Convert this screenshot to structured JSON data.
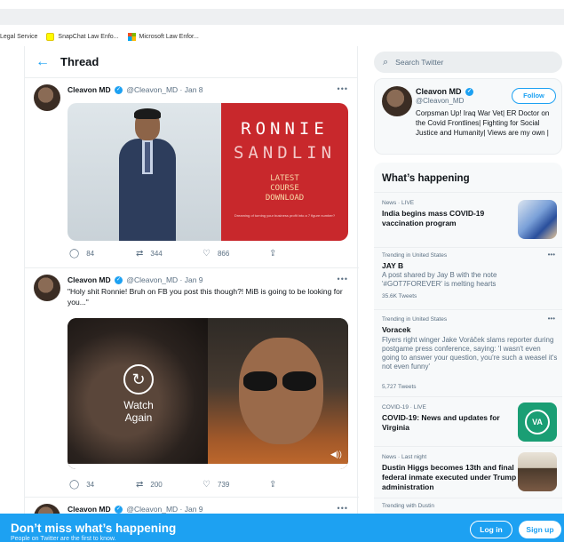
{
  "bookmarks": [
    {
      "label": "Legal Service",
      "icon": "none"
    },
    {
      "label": "SnapChat Law Enfo...",
      "icon": "snapchat-icon"
    },
    {
      "label": "Microsoft Law Enfor...",
      "icon": "microsoft-icon"
    }
  ],
  "thread": {
    "back_icon": "←",
    "title": "Thread"
  },
  "tweets": [
    {
      "name": "Cleavon MD",
      "handle": "@Cleavon_MD",
      "date": "· Jan 8",
      "text": "",
      "media": {
        "name_line1": "RONNIE",
        "name_line2": "SANDLIN",
        "sub_line1": "LATEST",
        "sub_line2": "COURSE",
        "sub_line3": "DOWNLOAD",
        "tiny_text": "Dreaming of turning your business profit into a 7 figure number?"
      },
      "replies": "84",
      "retweets": "344",
      "likes": "866"
    },
    {
      "name": "Cleavon MD",
      "handle": "@Cleavon_MD",
      "date": "· Jan 9",
      "text": "\"Holy shit Ronnie! Bruh on FB you post this though?! MiB is going to be looking for you...\"",
      "media": {
        "watch_label_1": "Watch",
        "watch_label_2": "Again"
      },
      "replies": "34",
      "retweets": "200",
      "likes": "739"
    },
    {
      "name": "Cleavon MD",
      "handle": "@Cleavon_MD",
      "date": "· Jan 9"
    }
  ],
  "search": {
    "placeholder": "Search Twitter"
  },
  "profile": {
    "name": "Cleavon MD",
    "handle": "@Cleavon_MD",
    "follow_label": "Follow",
    "bio": "Corpsman Up! Iraq War Vet| ER Doctor on the Covid Frontlines| Fighting for Social Justice and Humanity| Views are my own |"
  },
  "happening": {
    "title": "What’s happening",
    "trends": [
      {
        "meta": "News · LIVE",
        "title": "India begins mass COVID-19 vaccination program",
        "desc": "",
        "count": ""
      },
      {
        "meta": "Trending in United States",
        "title": "JAY B",
        "desc": "A post shared by Jay B with the note '#GOT7FOREVER' is melting hearts",
        "count": "35.6K Tweets"
      },
      {
        "meta": "Trending in United States",
        "title": "Voracek",
        "desc": "Flyers right winger Jake Voráček slams reporter during postgame press conference, saying: 'I wasn't even going to answer your question, you're such a weasel it's not even funny'",
        "count": "5,727 Tweets"
      },
      {
        "meta": "COVID-19 · LIVE",
        "title": "COVID-19: News and updates for Virginia",
        "desc": "",
        "count": ""
      },
      {
        "meta": "News · Last night",
        "title": "Dustin Higgs becomes 13th and final federal inmate executed under Trump administration",
        "desc": "",
        "count": ""
      },
      {
        "meta": "Trending with Dustin",
        "title": "",
        "desc": "",
        "count": ""
      }
    ],
    "va_badge": "VA"
  },
  "banner": {
    "title": "Don’t miss what’s happening",
    "subtitle": "People on Twitter are the first to know.",
    "login_label": "Log in",
    "signup_label": "Sign up"
  },
  "colors": {
    "accent": "#1da1f2",
    "media_red": "#c8282c"
  }
}
